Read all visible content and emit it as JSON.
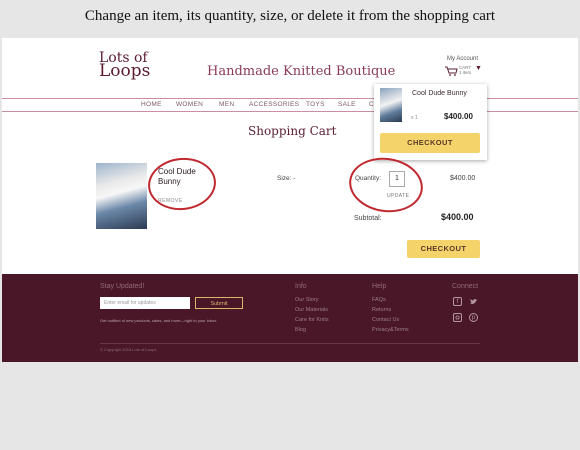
{
  "caption": "Change an item, its quantity, size, or delete it from the shopping cart",
  "header": {
    "logo_line1": "Lots of",
    "logo_line2": "Loops",
    "brand": "Handmade Knitted Boutique",
    "account": "My Account",
    "cart_label": "CART",
    "cart_count": "1 item"
  },
  "nav": [
    "HOME",
    "WOMEN",
    "MEN",
    "ACCESSORIES",
    "TOYS",
    "SALE",
    "C"
  ],
  "dropdown": {
    "product_name": "Cool Dude Bunny",
    "qty": "x 1",
    "price": "$400.00",
    "checkout": "CHECKOUT"
  },
  "cart": {
    "title": "Shopping Cart",
    "product_name": "Cool Dude Bunny",
    "remove": "REMOVE",
    "size_label": "Size: -",
    "qty_label": "Quantity:",
    "qty_value": "1",
    "update": "UPDATE",
    "line_price": "$400.00",
    "subtotal_label": "Subtotal:",
    "subtotal_value": "$400.00",
    "checkout": "CHECKOUT"
  },
  "footer": {
    "stay_updated": "Stay Updated!",
    "email_placeholder": "Enter email for updates",
    "submit": "Submit",
    "fine_print": "Get notified of new products, sales, and more—right to your inbox.",
    "info_heading": "Info",
    "info_links": [
      "Our Story",
      "Our Materials",
      "Care for Knits",
      "Blog"
    ],
    "help_heading": "Help",
    "help_links": [
      "FAQs",
      "Returns",
      "Contact Us",
      "Privacy&Terms"
    ],
    "connect_heading": "Connect",
    "copyright": "© Copyright 2015 Lots of Loops"
  },
  "colors": {
    "accent": "#5a1c32",
    "footer_bg": "#4a1729",
    "checkout": "#f4d46a",
    "annotation": "#c0282f"
  }
}
